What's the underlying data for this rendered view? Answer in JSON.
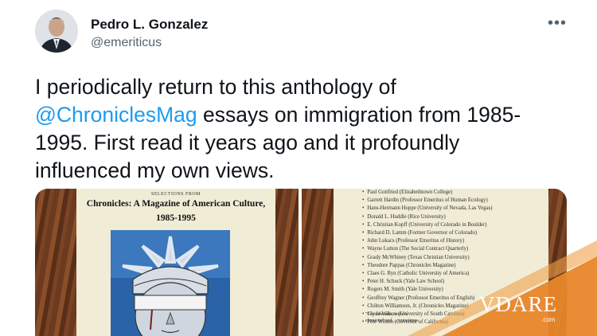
{
  "author": {
    "name": "Pedro L. Gonzalez",
    "handle": "@emeriticus"
  },
  "more_icon": "more-horizontal-icon",
  "tweet": {
    "text_before": "I periodically return to this anthology of ",
    "mention": "@ChroniclesMag",
    "text_after": " essays on immigration from 1985-1995. First read it years ago and it profoundly influenced my own views."
  },
  "colors": {
    "mention": "#1d9bf0",
    "handle": "#536471",
    "watermark": "#e8862a"
  },
  "book_cover": {
    "selections_label": "SELECTIONS FROM",
    "title": "Chronicles: A Magazine of American Culture,",
    "years": "1985-1995"
  },
  "contributors": [
    "Paul Gottfried (Elizabethtown College)",
    "Garrett Hardin (Professor Emeritus of Human Ecology)",
    "Hans-Hermann Hoppe (University of Nevada, Las Vegas)",
    "Donald L. Huddle (Rice University)",
    "E. Christian Kopff (University of Colorado in Boulder)",
    "Richard D. Lamm (Former Governor of Colorado)",
    "John Lukacs (Professor Emeritus of History)",
    "Wayne Lutton (The Social Contract Quarterly)",
    "Grady McWhiney (Texas Christian University)",
    "Theodore Pappas (Chronicles Magazine)",
    "Claes G. Ryn (Catholic University of America)",
    "Peter H. Schuck (Yale Law School)",
    "Rogers M. Smith (Yale University)",
    "Geoffrey Wagner (Professor Emeritus of English)",
    "Chilton Williamson, Jr. (Chronicles Magazine)",
    "Clyde Wilson (University of South Carolina)",
    "Pete Wilson (Governor of California)"
  ],
  "book_page_footnote": "\"For a decade, writers elemental and ... sometimes",
  "watermark": {
    "brand": "VDARE",
    "domain": ".com"
  }
}
